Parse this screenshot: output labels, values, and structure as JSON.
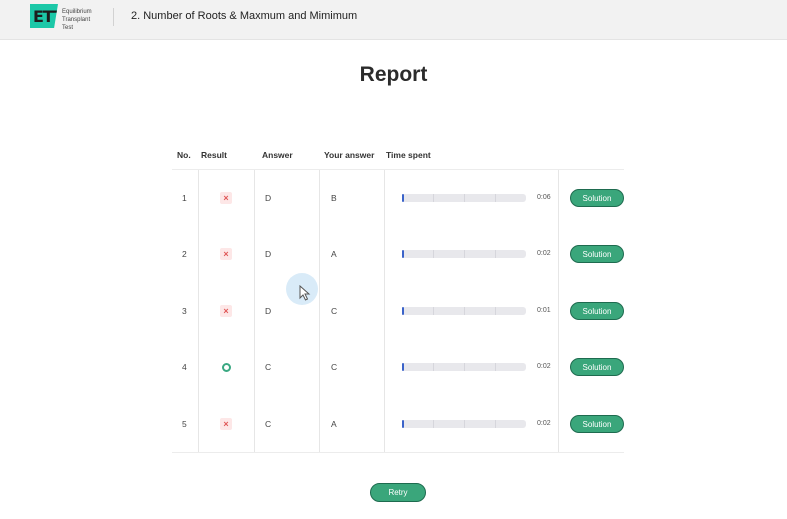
{
  "header": {
    "logo_mark": "ETT",
    "logo_text": "Equilibrium Transplant Test",
    "title": "2. Number of Roots & Maxmum and Mimimum"
  },
  "report": {
    "heading": "Report",
    "columns": {
      "no": "No.",
      "result": "Result",
      "answer": "Answer",
      "your_answer": "Your answer",
      "time_spent": "Time spent"
    },
    "rows": [
      {
        "no": "1",
        "result": "wrong",
        "answer": "D",
        "your_answer": "B",
        "time": "0:06",
        "fraction": 0.02,
        "solution_label": "Solution"
      },
      {
        "no": "2",
        "result": "wrong",
        "answer": "D",
        "your_answer": "A",
        "time": "0:02",
        "fraction": 0.01,
        "solution_label": "Solution"
      },
      {
        "no": "3",
        "result": "wrong",
        "answer": "D",
        "your_answer": "C",
        "time": "0:01",
        "fraction": 0.01,
        "solution_label": "Solution"
      },
      {
        "no": "4",
        "result": "correct",
        "answer": "C",
        "your_answer": "C",
        "time": "0:02",
        "fraction": 0.01,
        "solution_label": "Solution"
      },
      {
        "no": "5",
        "result": "wrong",
        "answer": "C",
        "your_answer": "A",
        "time": "0:02",
        "fraction": 0.01,
        "solution_label": "Solution"
      }
    ],
    "retry_label": "Retry"
  },
  "colors": {
    "accent_green": "#3aa67b",
    "wrong_red": "#e05656",
    "progress_blue": "#3b63c9",
    "logo_teal": "#1cc8a8"
  },
  "icons": {
    "wrong": "x-mark-icon",
    "correct": "circle-check-icon",
    "cursor": "mouse-pointer-icon"
  }
}
